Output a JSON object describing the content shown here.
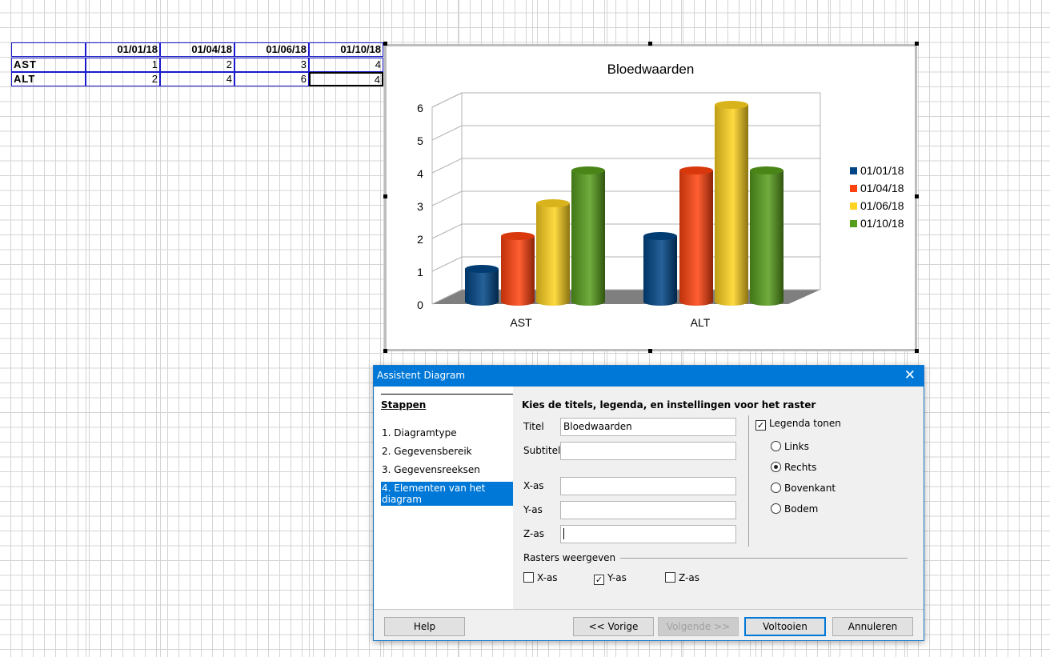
{
  "sheet": {
    "headers": [
      "",
      "01/01/18",
      "01/04/18",
      "01/06/18",
      "01/10/18"
    ],
    "rows": [
      {
        "label": "AST",
        "values": [
          "1",
          "2",
          "3",
          "4"
        ]
      },
      {
        "label": "ALT",
        "values": [
          "2",
          "4",
          "6",
          "4"
        ]
      }
    ]
  },
  "chart_data": {
    "type": "bar",
    "title": "Bloedwaarden",
    "categories": [
      "AST",
      "ALT"
    ],
    "series": [
      {
        "name": "01/01/18",
        "values": [
          1,
          2
        ],
        "color": "#004586"
      },
      {
        "name": "01/04/18",
        "values": [
          2,
          4
        ],
        "color": "#ff420e"
      },
      {
        "name": "01/06/18",
        "values": [
          3,
          6
        ],
        "color": "#ffd320"
      },
      {
        "name": "01/10/18",
        "values": [
          4,
          4
        ],
        "color": "#579d1c"
      }
    ],
    "yticks": [
      "0",
      "1",
      "2",
      "3",
      "4",
      "5",
      "6"
    ],
    "ylim": [
      0,
      6
    ],
    "grid": "y",
    "legend": "right",
    "style": "3d-cylinder"
  },
  "dialog": {
    "title": "Assistent Diagram",
    "steps_heading": "Stappen",
    "steps": [
      "1. Diagramtype",
      "2. Gegevensbereik",
      "3. Gegevensreeksen",
      "4. Elementen van het diagram"
    ],
    "heading": "Kies de titels, legenda, en instellingen voor het raster",
    "fields": {
      "titel_label": "Titel",
      "titel_value": "Bloedwaarden",
      "subtitel_label": "Subtitel",
      "subtitel_value": "",
      "xas_label": "X-as",
      "yas_label": "Y-as",
      "zas_label": "Z-as"
    },
    "legend_show": "Legenda tonen",
    "legend_positions": [
      "Links",
      "Rechts",
      "Bovenkant",
      "Bodem"
    ],
    "legend_selected": "Rechts",
    "grid_heading": "Rasters weergeven",
    "grid": {
      "x": "X-as",
      "y": "Y-as",
      "z": "Z-as"
    },
    "buttons": {
      "help": "Help",
      "prev": "<< Vorige",
      "next": "Volgende >>",
      "finish": "Voltooien",
      "cancel": "Annuleren"
    }
  }
}
